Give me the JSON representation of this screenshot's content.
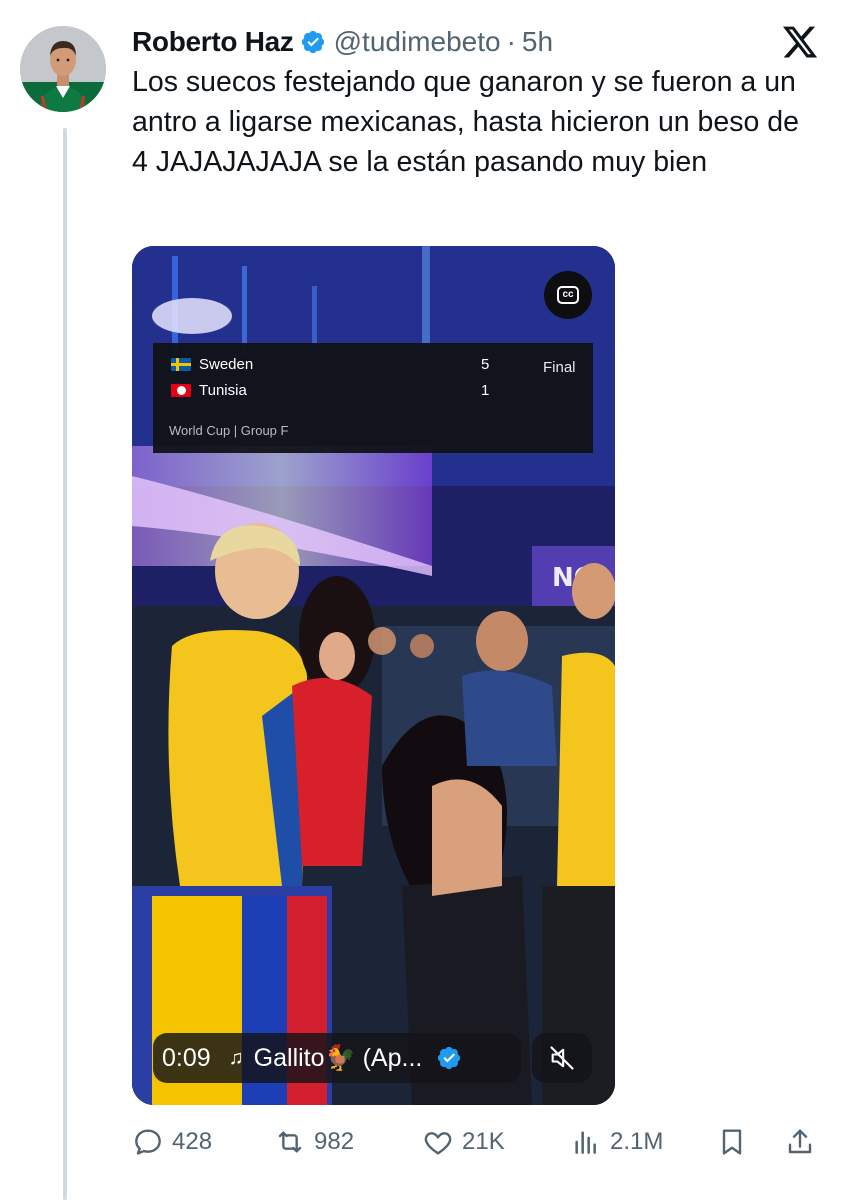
{
  "post": {
    "author_name": "Roberto Haz",
    "handle": "@tudimebeto",
    "separator": "·",
    "time": "5h",
    "text": "Los suecos festejando que ganaron y se fueron a un antro a ligarse mexicanas, hasta hicieron un beso de 4 JAJAJAJAJA se la están pasando muy bien"
  },
  "video": {
    "score_card": {
      "team1": "Sweden",
      "team1_score": "5",
      "team2": "Tunisia",
      "team2_score": "1",
      "status": "Final",
      "competition": "World Cup | Group F"
    },
    "time": "0:09",
    "channel": "Gallito🐓 (Ap...",
    "cc_label": "cc"
  },
  "actions": {
    "replies": "428",
    "reposts": "982",
    "likes": "21K",
    "views": "2.1M"
  },
  "colors": {
    "verified": "#1d9bf0",
    "muted_text": "#536471",
    "thread_line": "#cfd9de"
  },
  "icons": [
    "verified-badge-icon",
    "x-logo-icon",
    "cc-icon",
    "music-note-icon",
    "mute-icon",
    "reply-icon",
    "repost-icon",
    "like-icon",
    "views-icon",
    "bookmark-icon",
    "share-icon"
  ]
}
